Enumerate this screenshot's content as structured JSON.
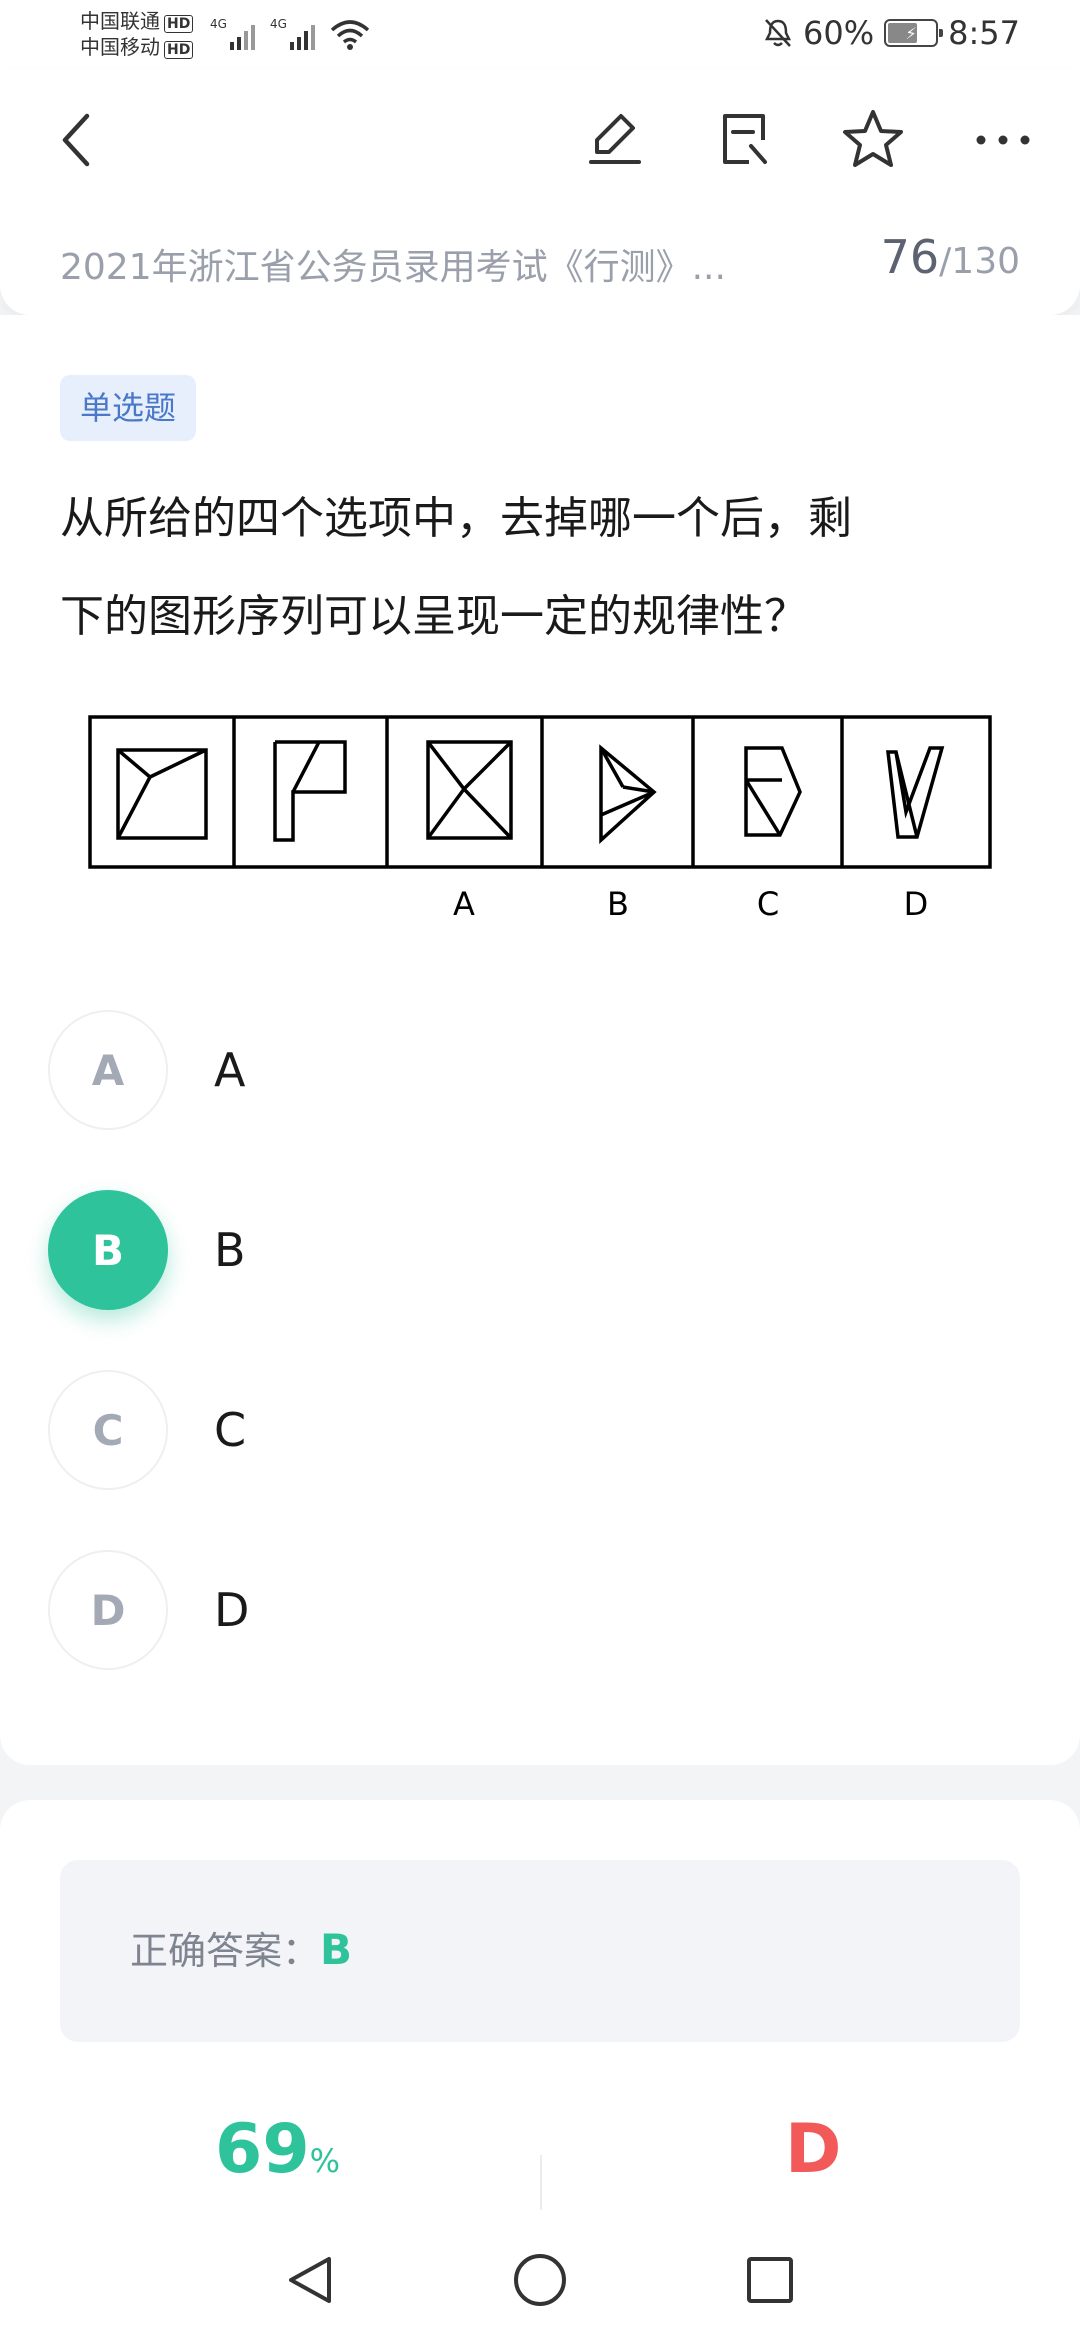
{
  "status_bar": {
    "carrier1": "中国联通",
    "carrier2": "中国移动",
    "hd": "HD",
    "network1": "4G",
    "network2": "4G",
    "battery": "60%",
    "time": "8:57"
  },
  "header": {
    "exam_title": "2021年浙江省公务员录用考试《行测》...",
    "progress_current": "76",
    "progress_total": "/130"
  },
  "question": {
    "type_tag": "单选题",
    "stem_line1": "从所给的四个选项中，去掉哪一个后，剩",
    "stem_line2": "下的图形序列可以呈现一定的规律性？",
    "figure_labels": [
      "A",
      "B",
      "C",
      "D"
    ]
  },
  "options": [
    {
      "letter": "A",
      "text": "A",
      "selected": false
    },
    {
      "letter": "B",
      "text": "B",
      "selected": true
    },
    {
      "letter": "C",
      "text": "C",
      "selected": false
    },
    {
      "letter": "D",
      "text": "D",
      "selected": false
    }
  ],
  "answer": {
    "label": "正确答案：",
    "value": "B",
    "accuracy_value": "69",
    "accuracy_unit": "%",
    "common_wrong": "D"
  },
  "colors": {
    "accent_green": "#2ec39b",
    "wrong_red": "#f25a5a",
    "tag_blue": "#4a79c9"
  },
  "icons": [
    "back-icon",
    "edit-icon",
    "note-icon",
    "star-icon",
    "more-icon",
    "nav-back-icon",
    "nav-home-icon",
    "nav-recent-icon"
  ]
}
